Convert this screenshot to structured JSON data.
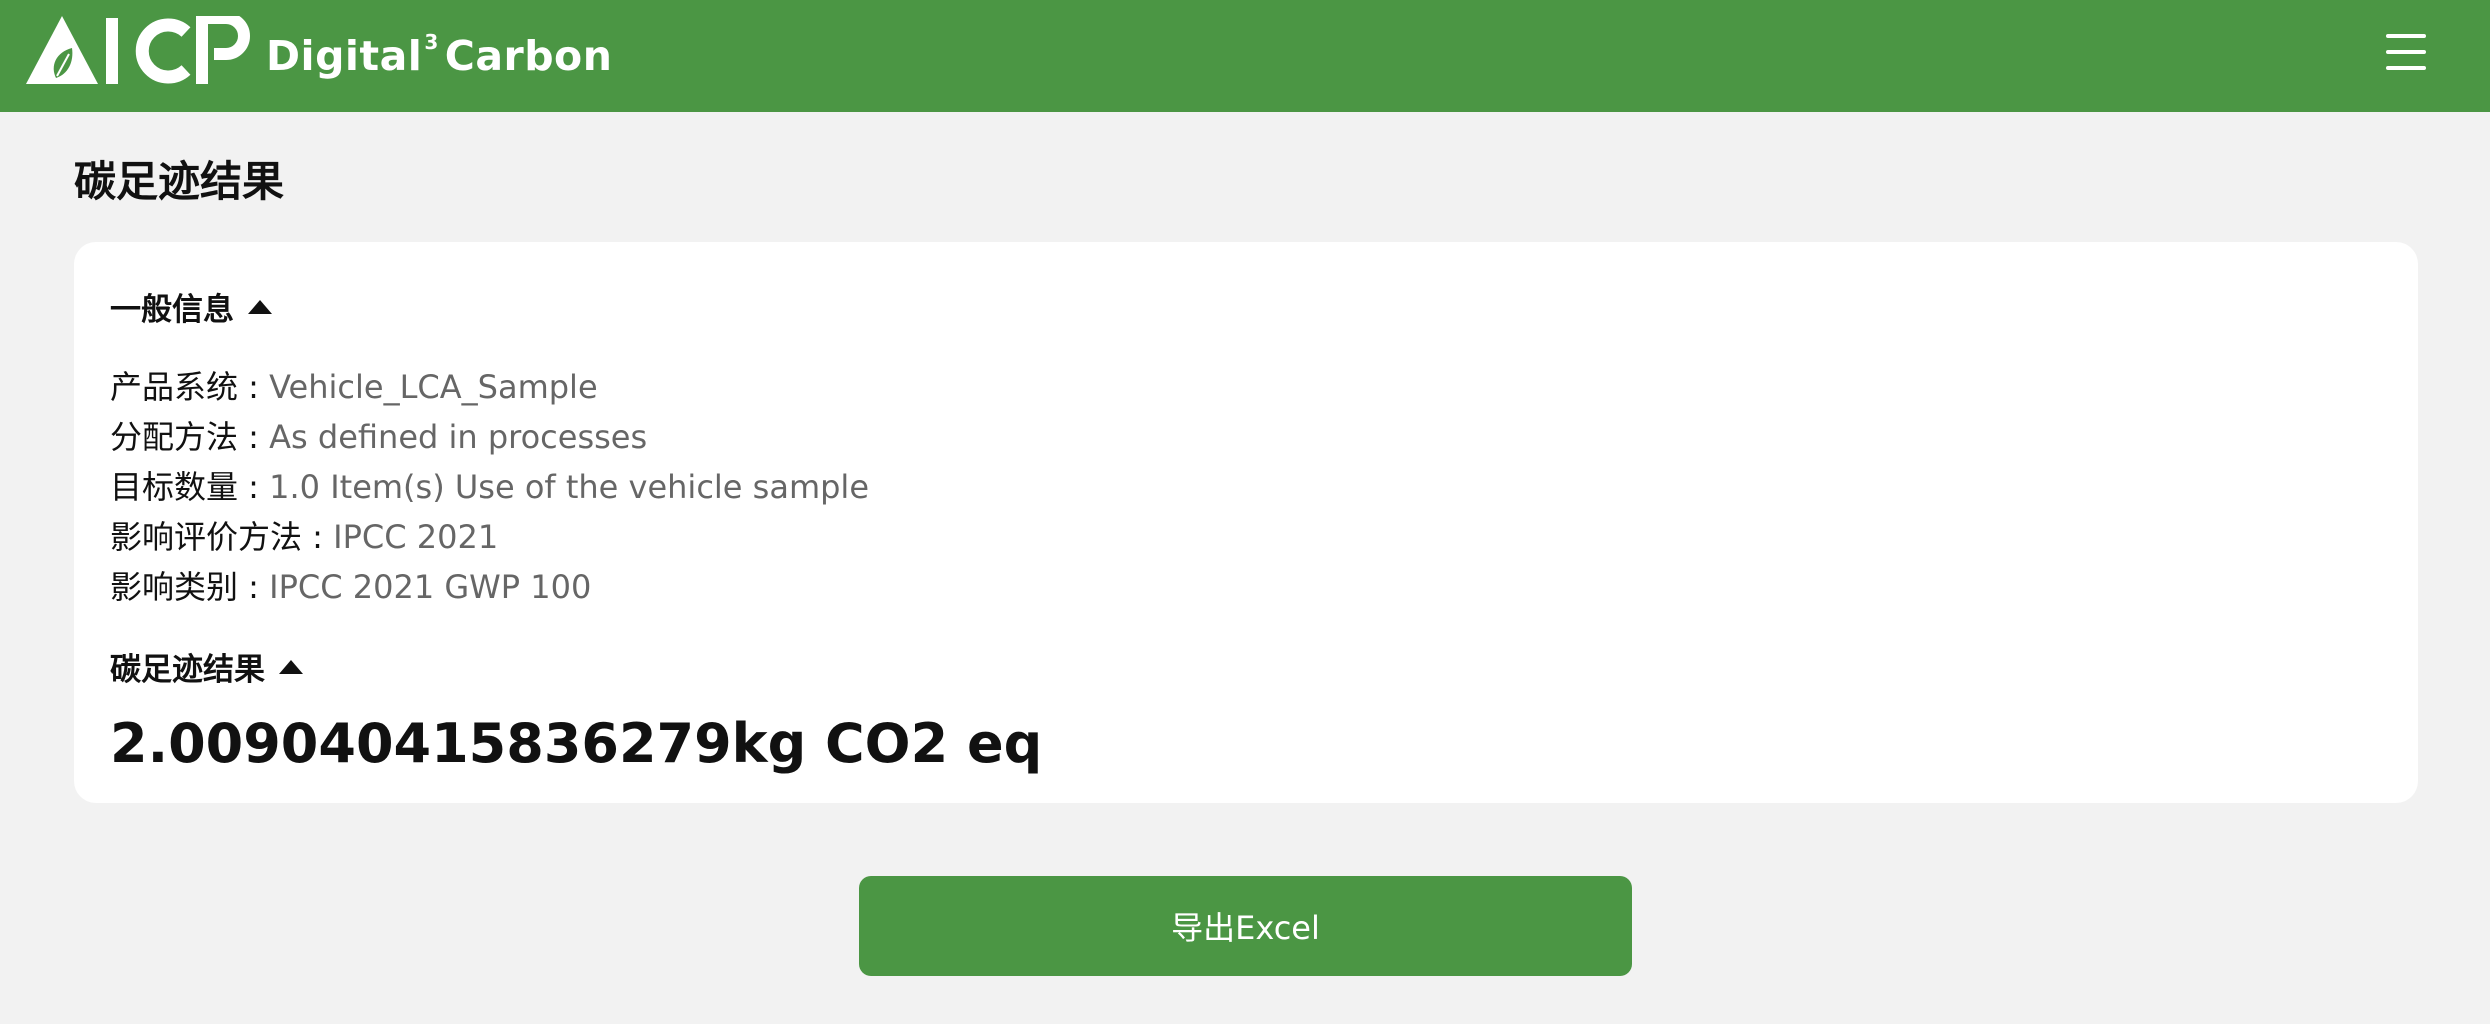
{
  "header": {
    "logo_text": "AICP",
    "brand_name": "Digital",
    "brand_superscript": "3",
    "brand_suffix": "Carbon",
    "menu_icon": "hamburger-menu-icon"
  },
  "page": {
    "title": "碳足迹结果"
  },
  "general_info": {
    "heading": "一般信息",
    "rows": [
      {
        "label": "产品系统 : ",
        "value": "Vehicle_LCA_Sample"
      },
      {
        "label": "分配方法 : ",
        "value": "As defined in processes"
      },
      {
        "label": "目标数量 : ",
        "value": "1.0 Item(s) Use of the vehicle sample"
      },
      {
        "label": "影响评价方法 : ",
        "value": "IPCC 2021"
      },
      {
        "label": "影响类别 : ",
        "value": "IPCC 2021 GWP 100"
      }
    ]
  },
  "result": {
    "heading": "碳足迹结果",
    "value": "2.009040415836279kg CO2 eq"
  },
  "actions": {
    "export_label": "导出Excel"
  },
  "colors": {
    "primary_green": "#4b9644",
    "background": "#f2f2f2",
    "card": "#ffffff",
    "value_gray": "#666666"
  }
}
